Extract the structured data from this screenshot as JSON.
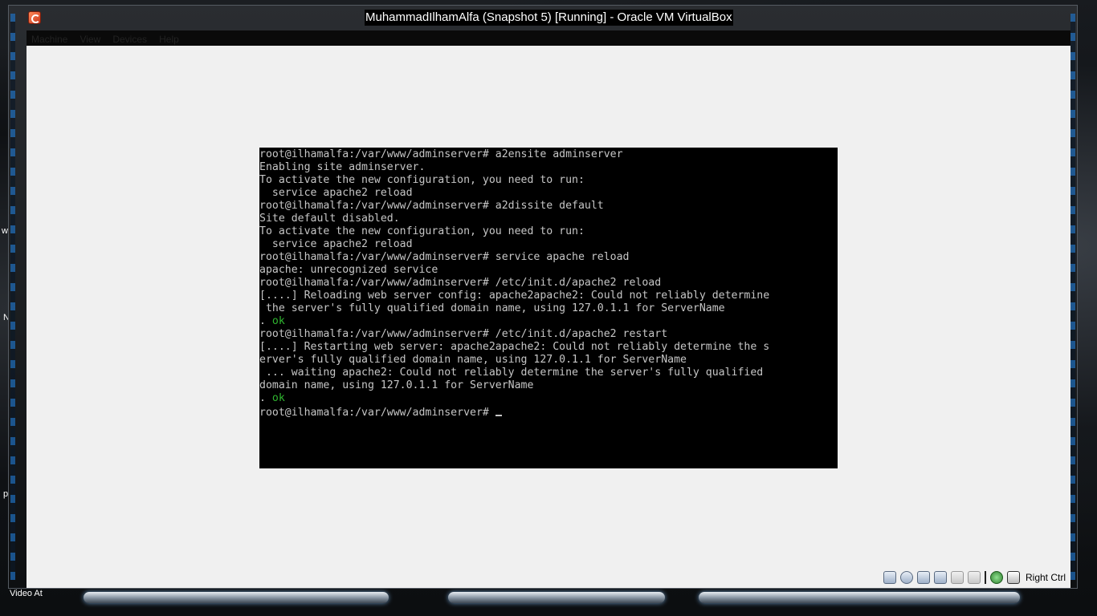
{
  "window": {
    "title": "MuhammadIlhamAlfa (Snapshot 5) [Running] - Oracle VM VirtualBox"
  },
  "menu": {
    "items": [
      "Machine",
      "View",
      "Devices",
      "Help"
    ]
  },
  "console": {
    "lines": [
      "root@ilhamalfa:/var/www/adminserver# a2ensite adminserver",
      "Enabling site adminserver.",
      "To activate the new configuration, you need to run:",
      "  service apache2 reload",
      "root@ilhamalfa:/var/www/adminserver# a2dissite default",
      "Site default disabled.",
      "To activate the new configuration, you need to run:",
      "  service apache2 reload",
      "root@ilhamalfa:/var/www/adminserver# service apache reload",
      "apache: unrecognized service",
      "root@ilhamalfa:/var/www/adminserver# /etc/init.d/apache2 reload",
      "[....] Reloading web server config: apache2apache2: Could not reliably determine",
      " the server's fully qualified domain name, using 127.0.1.1 for ServerName",
      ". ",
      "root@ilhamalfa:/var/www/adminserver# /etc/init.d/apache2 restart",
      "[....] Restarting web server: apache2apache2: Could not reliably determine the s",
      "erver's fully qualified domain name, using 127.0.1.1 for ServerName",
      " ... waiting apache2: Could not reliably determine the server's fully qualified",
      "domain name, using 127.0.1.1 for ServerName",
      ". ",
      "root@ilhamalfa:/var/www/adminserver# "
    ],
    "ok_text": "ok",
    "ok_color": "#2fb52f"
  },
  "statusbar": {
    "icons": [
      "hard-disk-icon",
      "optical-drive-icon",
      "usb-icon",
      "network-icon",
      "shared-folder-icon",
      "display-icon",
      "capture-icon",
      "mouse-integration-icon"
    ],
    "host_key": "Right Ctrl"
  },
  "desktop": {
    "fragments": [
      "wi",
      "N",
      "po",
      "Video At"
    ]
  }
}
